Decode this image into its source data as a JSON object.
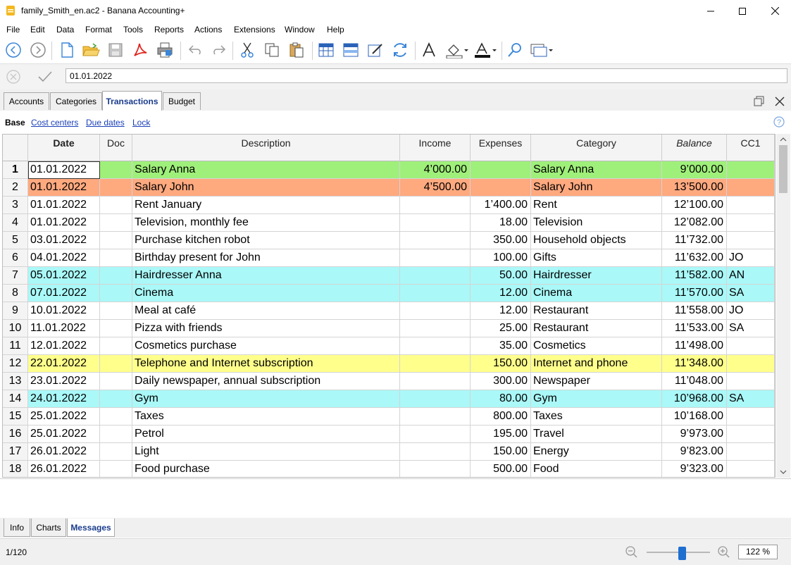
{
  "window": {
    "title": "family_Smith_en.ac2 - Banana Accounting+",
    "controls": [
      "minimize",
      "maximize",
      "close"
    ]
  },
  "menu": [
    "File",
    "Edit",
    "Data",
    "Format",
    "Tools",
    "Reports",
    "Actions",
    "Extensions",
    "Window",
    "Help"
  ],
  "toolbar": {
    "icons": [
      "back-icon",
      "forward-icon",
      "new-file-icon",
      "open-folder-icon",
      "save-icon",
      "pdf-icon",
      "print-icon",
      "undo-icon",
      "redo-icon",
      "cut-icon",
      "copy-icon",
      "paste-icon",
      "insert-row-icon",
      "delete-row-icon",
      "edit-row-icon",
      "recalculate-icon",
      "font-icon",
      "fill-color-icon",
      "text-color-icon",
      "find-icon",
      "window-menu-icon"
    ]
  },
  "edit_bar": {
    "value": "01.01.2022"
  },
  "tabs": [
    "Accounts",
    "Categories",
    "Transactions",
    "Budget"
  ],
  "active_tab": "Transactions",
  "views": {
    "base": "Base",
    "links": [
      "Cost centers",
      "Due dates",
      "Lock"
    ]
  },
  "table": {
    "columns": [
      "Date",
      "Doc",
      "Description",
      "Income",
      "Expenses",
      "Category",
      "Balance",
      "CC1"
    ],
    "rows": [
      {
        "n": "1",
        "date": "01.01.2022",
        "doc": "",
        "desc": "Salary Anna",
        "income": "4’000.00",
        "expenses": "",
        "category": "Salary Anna",
        "balance": "9’000.00",
        "cc1": "",
        "bg": "#9ff07a"
      },
      {
        "n": "2",
        "date": "01.01.2022",
        "doc": "",
        "desc": "Salary John",
        "income": "4’500.00",
        "expenses": "",
        "category": "Salary John",
        "balance": "13’500.00",
        "cc1": "",
        "bg": "#ffa97f"
      },
      {
        "n": "3",
        "date": "01.01.2022",
        "doc": "",
        "desc": "Rent January",
        "income": "",
        "expenses": "1’400.00",
        "category": "Rent",
        "balance": "12’100.00",
        "cc1": "",
        "bg": "#ffffff"
      },
      {
        "n": "4",
        "date": "01.01.2022",
        "doc": "",
        "desc": "Television, monthly fee",
        "income": "",
        "expenses": "18.00",
        "category": "Television",
        "balance": "12’082.00",
        "cc1": "",
        "bg": "#ffffff"
      },
      {
        "n": "5",
        "date": "03.01.2022",
        "doc": "",
        "desc": "Purchase kitchen robot",
        "income": "",
        "expenses": "350.00",
        "category": "Household objects",
        "balance": "11’732.00",
        "cc1": "",
        "bg": "#ffffff"
      },
      {
        "n": "6",
        "date": "04.01.2022",
        "doc": "",
        "desc": "Birthday present for John",
        "income": "",
        "expenses": "100.00",
        "category": "Gifts",
        "balance": "11’632.00",
        "cc1": "JO",
        "bg": "#ffffff"
      },
      {
        "n": "7",
        "date": "05.01.2022",
        "doc": "",
        "desc": "Hairdresser Anna",
        "income": "",
        "expenses": "50.00",
        "category": "Hairdresser",
        "balance": "11’582.00",
        "cc1": "AN",
        "bg": "#aaf8f8"
      },
      {
        "n": "8",
        "date": "07.01.2022",
        "doc": "",
        "desc": "Cinema",
        "income": "",
        "expenses": "12.00",
        "category": "Cinema",
        "balance": "11’570.00",
        "cc1": "SA",
        "bg": "#aaf8f8"
      },
      {
        "n": "9",
        "date": "10.01.2022",
        "doc": "",
        "desc": "Meal at café",
        "income": "",
        "expenses": "12.00",
        "category": "Restaurant",
        "balance": "11’558.00",
        "cc1": "JO",
        "bg": "#ffffff"
      },
      {
        "n": "10",
        "date": "11.01.2022",
        "doc": "",
        "desc": "Pizza with friends",
        "income": "",
        "expenses": "25.00",
        "category": "Restaurant",
        "balance": "11’533.00",
        "cc1": "SA",
        "bg": "#ffffff"
      },
      {
        "n": "11",
        "date": "12.01.2022",
        "doc": "",
        "desc": "Cosmetics purchase",
        "income": "",
        "expenses": "35.00",
        "category": "Cosmetics",
        "balance": "11’498.00",
        "cc1": "",
        "bg": "#ffffff"
      },
      {
        "n": "12",
        "date": "22.01.2022",
        "doc": "",
        "desc": "Telephone and Internet subscription",
        "income": "",
        "expenses": "150.00",
        "category": "Internet and phone",
        "balance": "11’348.00",
        "cc1": "",
        "bg": "#ffff8c"
      },
      {
        "n": "13",
        "date": "23.01.2022",
        "doc": "",
        "desc": "Daily newspaper, annual subscription",
        "income": "",
        "expenses": "300.00",
        "category": "Newspaper",
        "balance": "11’048.00",
        "cc1": "",
        "bg": "#ffffff"
      },
      {
        "n": "14",
        "date": "24.01.2022",
        "doc": "",
        "desc": "Gym",
        "income": "",
        "expenses": "80.00",
        "category": "Gym",
        "balance": "10’968.00",
        "cc1": "SA",
        "bg": "#aaf8f8"
      },
      {
        "n": "15",
        "date": "25.01.2022",
        "doc": "",
        "desc": "Taxes",
        "income": "",
        "expenses": "800.00",
        "category": "Taxes",
        "balance": "10’168.00",
        "cc1": "",
        "bg": "#ffffff"
      },
      {
        "n": "16",
        "date": "25.01.2022",
        "doc": "",
        "desc": "Petrol",
        "income": "",
        "expenses": "195.00",
        "category": "Travel",
        "balance": "9’973.00",
        "cc1": "",
        "bg": "#ffffff"
      },
      {
        "n": "17",
        "date": "26.01.2022",
        "doc": "",
        "desc": "Light",
        "income": "",
        "expenses": "150.00",
        "category": "Energy",
        "balance": "9’823.00",
        "cc1": "",
        "bg": "#ffffff"
      },
      {
        "n": "18",
        "date": "26.01.2022",
        "doc": "",
        "desc": "Food purchase",
        "income": "",
        "expenses": "500.00",
        "category": "Food",
        "balance": "9’323.00",
        "cc1": "",
        "bg": "#ffffff"
      }
    ]
  },
  "bottom_tabs": [
    "Info",
    "Charts",
    "Messages"
  ],
  "active_bottom_tab": "Messages",
  "status": {
    "position": "1/120",
    "zoom": "122 %",
    "zoom_level": 0.55
  }
}
